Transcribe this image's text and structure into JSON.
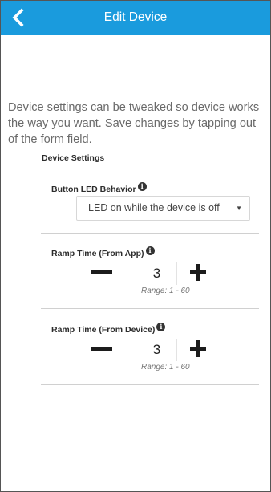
{
  "header": {
    "title": "Edit Device",
    "back_icon": "chevron-left-icon"
  },
  "intro_text": "Device settings can be tweaked so device works the way you want. Save changes by tapping out of the form field.",
  "settings": {
    "section_title": "Device Settings",
    "info_glyph": "i",
    "led_behavior": {
      "label": "Button LED Behavior",
      "selected": "LED on while the device is off",
      "caret": "▼"
    },
    "ramp_app": {
      "label": "Ramp Time (From App)",
      "value": "3",
      "range": "Range: 1 - 60"
    },
    "ramp_device": {
      "label": "Ramp Time (From Device)",
      "value": "3",
      "range": "Range: 1 - 60"
    }
  },
  "colors": {
    "header_bg": "#1a9bdd",
    "header_text": "#ffffff",
    "body_text": "#6a6a6a",
    "stepper_icon": "#1c1c1c"
  }
}
